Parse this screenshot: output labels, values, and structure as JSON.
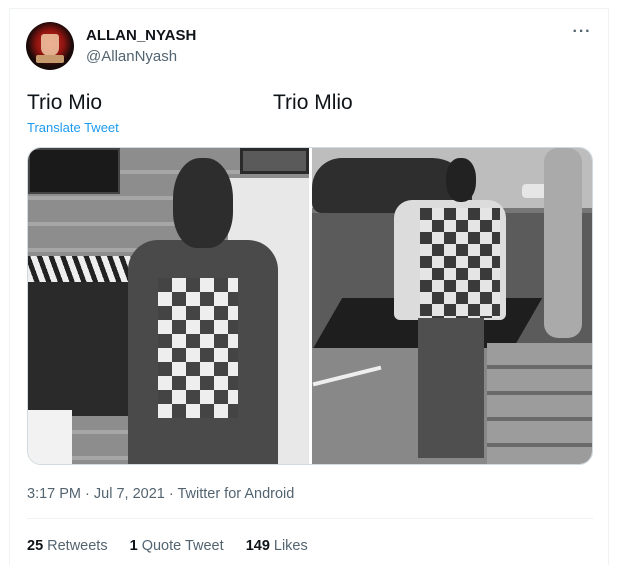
{
  "author": {
    "display_name": "ALLAN_NYASH",
    "handle": "@AllanNyash"
  },
  "tweet": {
    "text_left": "Trio Mio",
    "text_right": "Trio Mlio",
    "translate_label": "Translate Tweet",
    "more_icon": "more-dots-icon",
    "more_glyph": "···"
  },
  "media": {
    "photo_count": 2
  },
  "meta": {
    "timestamp": "3:17 PM · Jul 7, 2021 · Twitter for Android"
  },
  "stats": {
    "retweets_count": "25",
    "retweets_label": "Retweets",
    "quotes_count": "1",
    "quotes_label": "Quote Tweet",
    "likes_count": "149",
    "likes_label": "Likes"
  },
  "colors": {
    "link": "#1d9bf0",
    "text_primary": "#0f1419",
    "text_secondary": "#536471",
    "border": "#eff3f4"
  }
}
